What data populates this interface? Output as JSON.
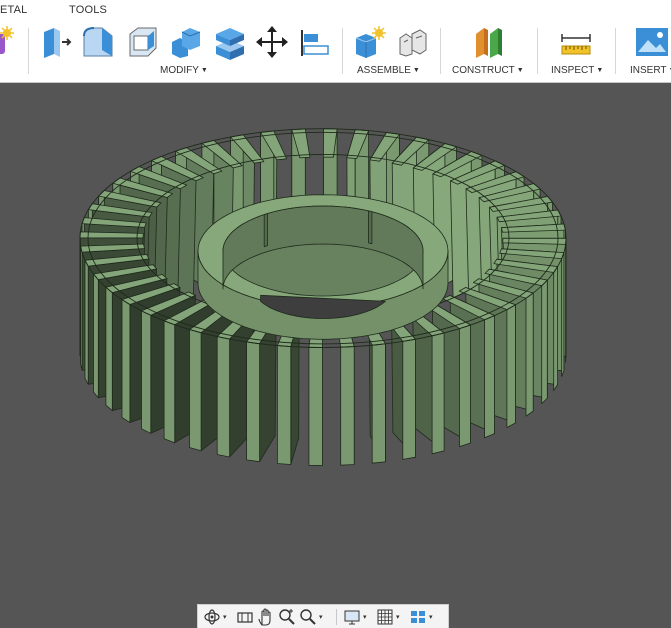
{
  "toolbar": {
    "tabs": [
      {
        "label": "ETAL"
      },
      {
        "label": "TOOLS"
      }
    ],
    "groups": {
      "modify": "MODIFY",
      "assemble": "ASSEMBLE",
      "construct": "CONSTRUCT",
      "inspect": "INSPECT",
      "insert": "INSERT"
    },
    "caret": "▼"
  },
  "icons": {
    "create_form": "create-form-icon",
    "press_pull": "press-pull-icon",
    "fillet": "fillet-icon",
    "shell": "shell-icon",
    "combine": "combine-icon",
    "scale": "scale-icon",
    "move": "move-icon",
    "align": "align-icon",
    "new_component": "new-component-icon",
    "joint": "joint-icon",
    "offset_plane": "offset-plane-icon",
    "measure": "measure-icon",
    "insert_image": "insert-image-icon"
  },
  "colors": {
    "model_fill": "#7a9970",
    "model_edge": "#1e2a1b",
    "viewport_bg": "#555555",
    "accent_blue": "#3b8fd6"
  },
  "navbar": {
    "caret": "▾"
  }
}
